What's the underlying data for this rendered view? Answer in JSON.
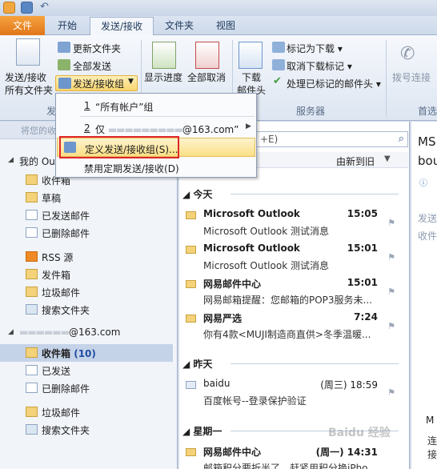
{
  "tabs": [
    "文件",
    "开始",
    "发送/接收",
    "文件夹",
    "视图"
  ],
  "ribbon": {
    "send_receive_all": [
      "发送/接收",
      "所有文件夹"
    ],
    "update_folder": "更新文件夹",
    "send_all": "全部发送",
    "send_receive_groups": "发送/接收组",
    "group_label_send": "发",
    "show_progress": "显示进度",
    "cancel_all": "全部取消",
    "download_headers": [
      "下载",
      "邮件头"
    ],
    "mark_download": "标记为下载",
    "unmark_download": "取消下载标记",
    "process_marked": "处理已标记的邮件头",
    "group_label_server": "服务器",
    "dial_up": "拨号连接",
    "group_label_pref": "首选"
  },
  "menu": {
    "items": [
      {
        "num": "1",
        "label": "“所有帐户”组"
      },
      {
        "num": "2",
        "label": "仅",
        "suffix": "@163.com”"
      },
      {
        "label": "定义发送/接收组(S)..."
      },
      {
        "label": "禁用定期发送/接收(D)"
      }
    ]
  },
  "nav": {
    "header": "将您的收",
    "account1": "我的 Ou",
    "folders1": [
      "收件箱",
      "草稿",
      "已发送邮件",
      "已删除邮件",
      "RSS 源",
      "发件箱",
      "垃圾邮件",
      "搜索文件夹"
    ],
    "account2": "@163.com",
    "folders2": [
      {
        "label": "收件箱",
        "count": "(10)"
      },
      {
        "label": "已发送"
      },
      {
        "label": "已删除邮件"
      },
      {
        "label": "垃圾邮件"
      },
      {
        "label": "搜索文件夹"
      }
    ]
  },
  "list": {
    "search_hint": "+E)",
    "sort": "由新到旧",
    "groups": [
      "今天",
      "昨天",
      "星期一"
    ],
    "messages": [
      {
        "sender": "Microsoft Outlook",
        "time": "15:05",
        "preview": "Microsoft Outlook 测试消息"
      },
      {
        "sender": "Microsoft Outlook",
        "time": "15:01",
        "preview": "Microsoft Outlook 测试消息"
      },
      {
        "sender": "网易邮件中心",
        "time": "15:01",
        "preview": "网易邮箱提醒：您邮箱的POP3服务未..."
      },
      {
        "sender": "网易严选",
        "time": "7:24",
        "preview": "你有4款<MUJI制造商直供>冬季温暖..."
      },
      {
        "sender": "baidu",
        "time": "(周三) 18:59",
        "preview": "百度帐号--登录保护验证"
      },
      {
        "sender": "网易邮件中心",
        "time": "(周一) 14:31",
        "preview": "邮箱积分要折半了，赶紧用积分换iPho"
      }
    ]
  },
  "reading": {
    "title_a": "MS",
    "title_b": "bou",
    "send_label": "发送",
    "recv_label": "收件",
    "bottom_a": "M",
    "bottom_b": "连接"
  },
  "watermark": "Baidu 经验"
}
